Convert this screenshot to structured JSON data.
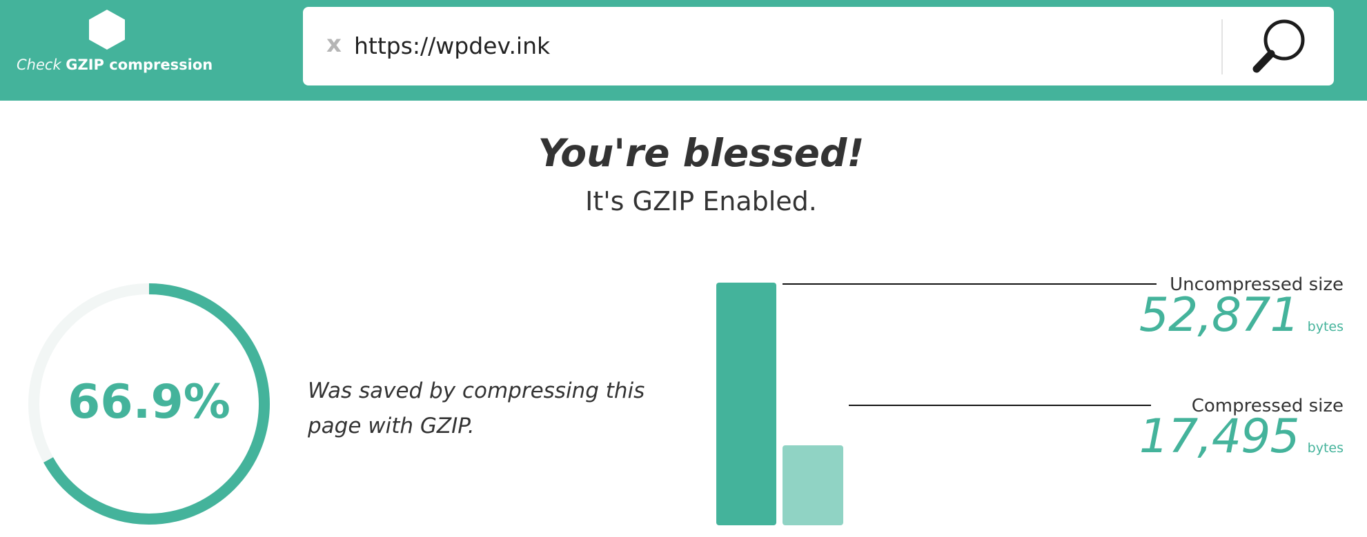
{
  "header": {
    "logo_light": "Check ",
    "logo_bold": "GZIP compression",
    "clear_label": "x",
    "url_value": "https://wpdev.ink",
    "logo_icon": "hexagon-icon",
    "search_icon": "magnifier-icon"
  },
  "result": {
    "headline": "You're blessed!",
    "subheadline": "It's GZIP Enabled.",
    "percent_label": "66.9%",
    "saved_fraction": 0.669,
    "saved_text": "Was saved by compressing this page with GZIP."
  },
  "sizes": {
    "uncompressed": {
      "label": "Uncompressed size",
      "value": "52,871",
      "bytes": 52871,
      "unit": "bytes"
    },
    "compressed": {
      "label": "Compressed size",
      "value": "17,495",
      "bytes": 17495,
      "unit": "bytes"
    }
  },
  "colors": {
    "accent": "#44b39b",
    "accent_light": "#90d3c4",
    "track": "#f2f6f5"
  }
}
